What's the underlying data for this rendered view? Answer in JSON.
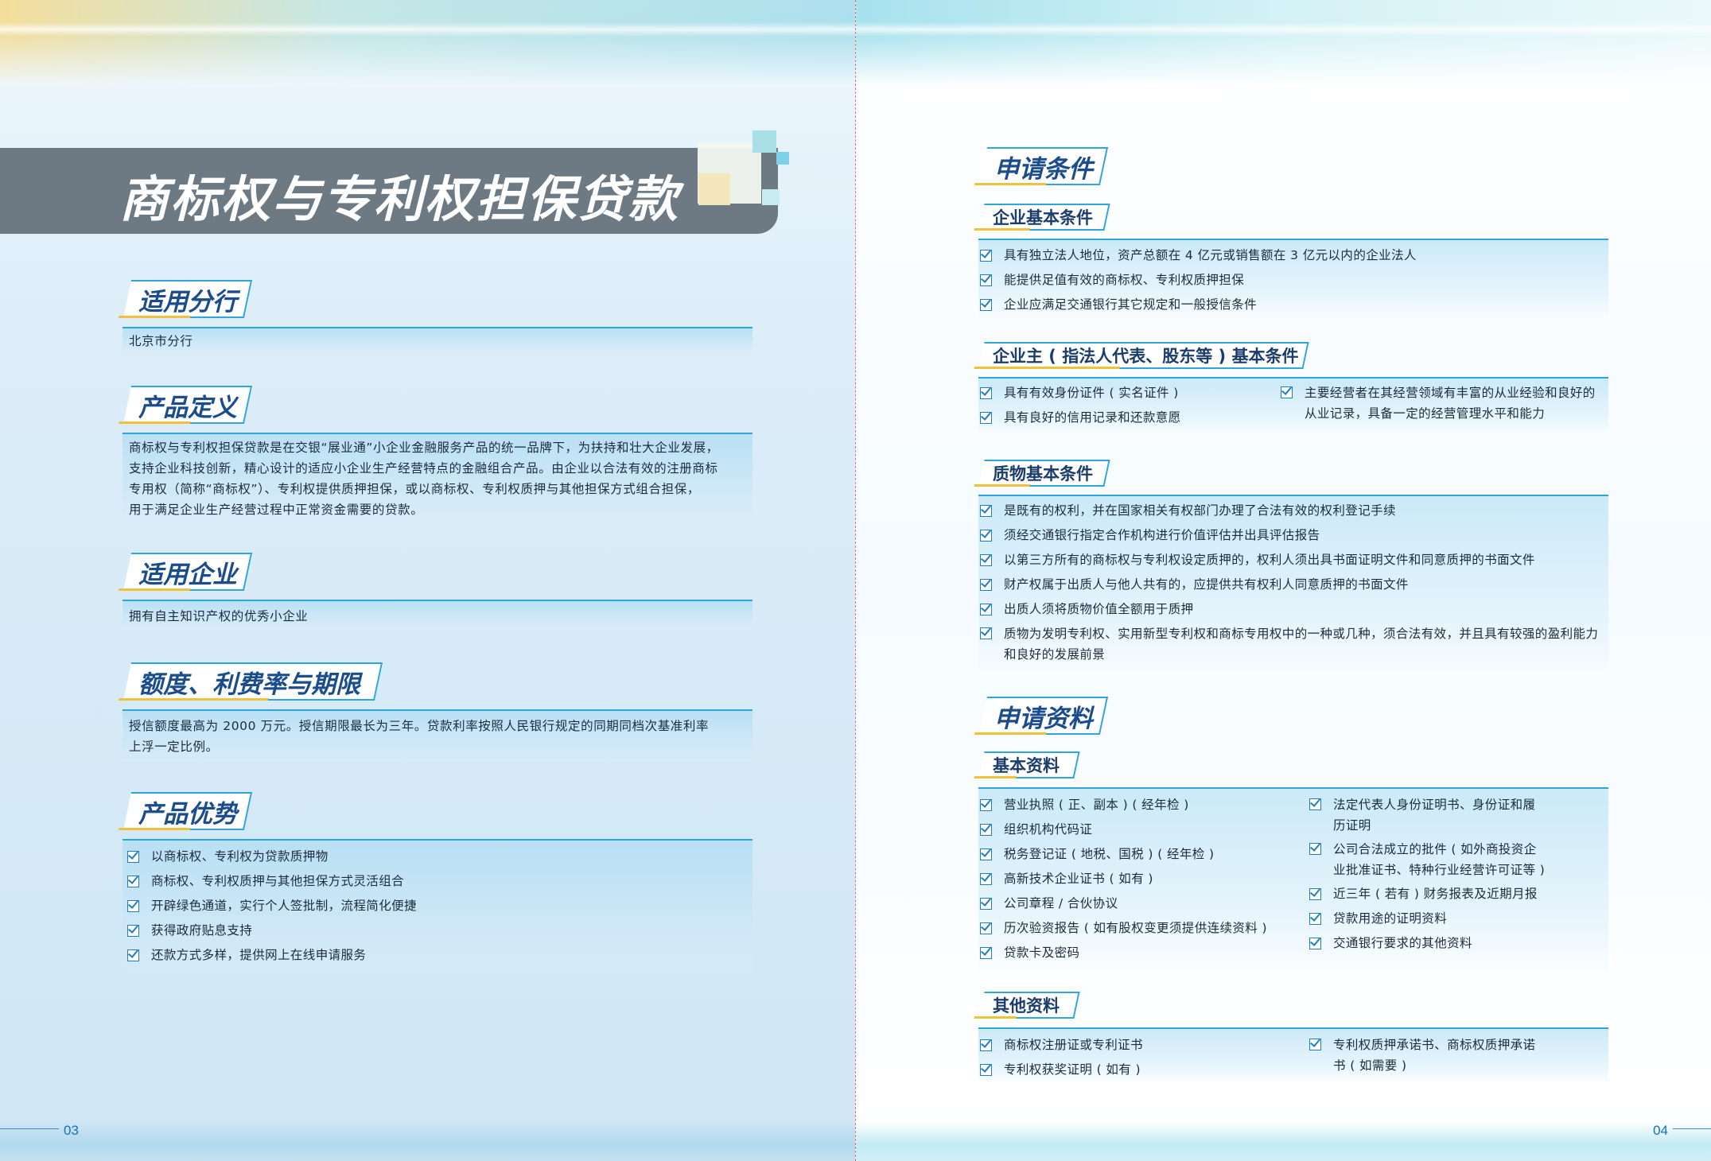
{
  "left": {
    "title": "商标权与专利权担保贷款",
    "page_number": "03",
    "sections": {
      "branch": {
        "heading": "适用分行",
        "text": "北京市分行"
      },
      "definition": {
        "heading": "产品定义",
        "lines": [
          "商标权与专利权担保贷款是在交银“展业通”小企业金融服务产品的统一品牌下，为扶持和壮大企业发展，",
          "支持企业科技创新，精心设计的适应小企业生产经营特点的金融组合产品。由企业以合法有效的注册商标",
          "专用权（简称“商标权”）、专利权提供质押担保，或以商标权、专利权质押与其他担保方式组合担保，",
          "用于满足企业生产经营过程中正常资金需要的贷款。"
        ]
      },
      "enterprise": {
        "heading": "适用企业",
        "text": "拥有自主知识产权的优秀小企业"
      },
      "limits": {
        "heading": "额度、利费率与期限",
        "lines": [
          "授信额度最高为 2000 万元。授信期限最长为三年。贷款利率按照人民银行规定的同期同档次基准利率",
          "上浮一定比例。"
        ]
      },
      "advantages": {
        "heading": "产品优势",
        "items": [
          "以商标权、专利权为贷款质押物",
          "商标权、专利权质押与其他担保方式灵活组合",
          "开辟绿色通道，实行个人签批制，流程简化便捷",
          "获得政府贴息支持",
          "还款方式多样，提供网上在线申请服务"
        ]
      }
    }
  },
  "right": {
    "page_number": "04",
    "conditions": {
      "heading": "申请条件",
      "enterprise_basic": {
        "heading": "企业基本条件",
        "items": [
          "具有独立法人地位，资产总额在 4 亿元或销售额在 3 亿元以内的企业法人",
          "能提供足值有效的商标权、专利权质押担保",
          "企业应满足交通银行其它规定和一般授信条件"
        ]
      },
      "owner_basic": {
        "heading": "企业主 ( 指法人代表、股东等 ) 基本条件",
        "items_left": [
          "具有有效身份证件 ( 实名证件 )",
          "具有良好的信用记录和还款意愿"
        ],
        "items_right": [
          "主要经营者在其经营领域有丰富的从业经验和良好的从业记录，具备一定的经营管理水平和能力"
        ]
      },
      "pledge_basic": {
        "heading": "质物基本条件",
        "items": [
          "是既有的权利，并在国家相关有权部门办理了合法有效的权利登记手续",
          "须经交通银行指定合作机构进行价值评估并出具评估报告",
          "以第三方所有的商标权与专利权设定质押的，权利人须出具书面证明文件和同意质押的书面文件",
          "财产权属于出质人与他人共有的，应提供共有权利人同意质押的书面文件",
          "出质人须将质物价值全额用于质押",
          "质物为发明专利权、实用新型专利权和商标专用权中的一种或几种，须合法有效，并且具有较强的盈利能力和良好的发展前景"
        ]
      }
    },
    "materials": {
      "heading": "申请资料",
      "basic": {
        "heading": "基本资料",
        "items_left": [
          "营业执照 ( 正、副本 ) ( 经年检 )",
          "组织机构代码证",
          "税务登记证 ( 地税、国税 ) ( 经年检 )",
          "高新技术企业证书 ( 如有 )",
          "公司章程 / 合伙协议",
          "历次验资报告 ( 如有股权变更须提供连续资料 )",
          "贷款卡及密码"
        ],
        "items_right": [
          "法定代表人身份证明书、身份证和履历证明",
          "公司合法成立的批件 ( 如外商投资企业批准证书、特种行业经营许可证等 )",
          "近三年 ( 若有 ) 财务报表及近期月报",
          "贷款用途的证明资料",
          "交通银行要求的其他资料"
        ]
      },
      "other": {
        "heading": "其他资料",
        "items_left": [
          "商标权注册证或专利证书",
          "专利权获奖证明 ( 如有 )"
        ],
        "items_right": [
          "专利权质押承诺书、商标权质押承诺书 ( 如需要 )"
        ]
      }
    }
  }
}
